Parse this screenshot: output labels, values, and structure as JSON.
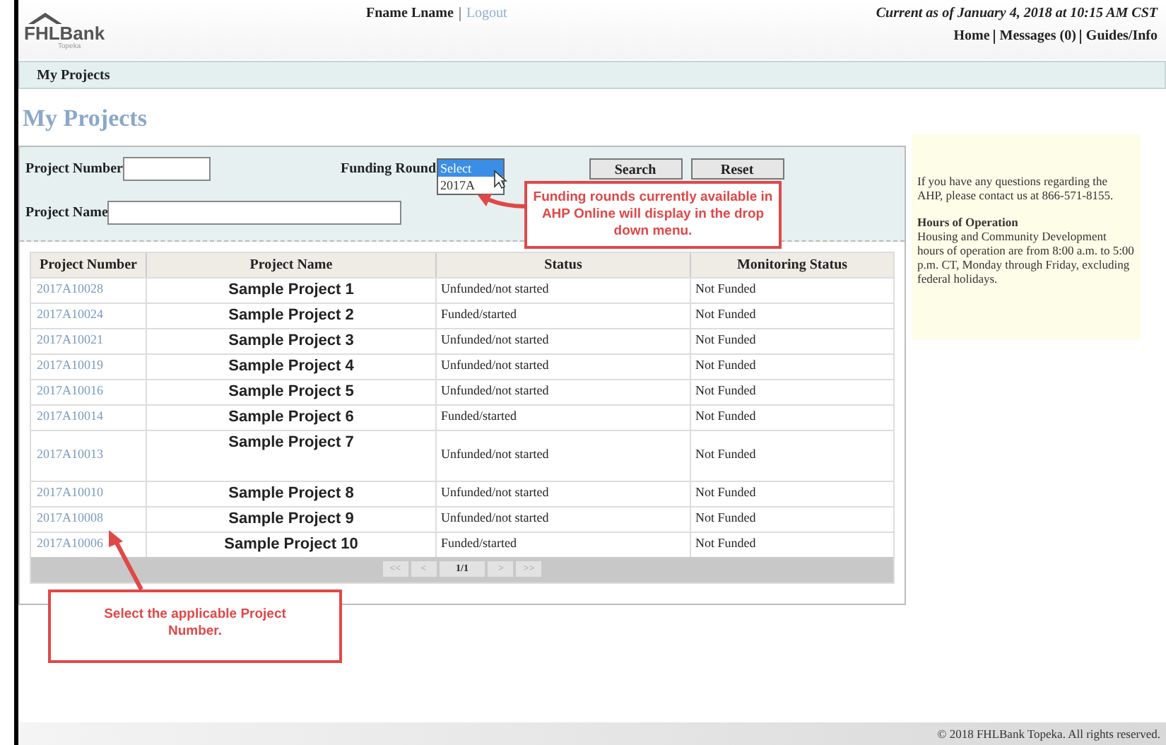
{
  "header": {
    "logo_name": "FHLBank",
    "logo_sub": "Topeka",
    "user": "Fname Lname",
    "logout": "Logout",
    "current_as_of": "Current as of January 4, 2018 at 10:15 AM CST",
    "links": [
      "Home",
      "Messages (0)",
      "Guides/Info"
    ]
  },
  "nav": {
    "items": [
      {
        "label": "My Projects",
        "selected": true
      }
    ]
  },
  "page_title": "My Projects",
  "search": {
    "project_number_label": "Project Number",
    "funding_round_label": "Funding Round",
    "project_name_label": "Project Name",
    "dropdown": {
      "expanded": true,
      "options": [
        {
          "label": "Select",
          "selected": true
        },
        {
          "label": "2017A",
          "selected": false
        }
      ]
    },
    "buttons": [
      "Search",
      "Reset"
    ]
  },
  "table": {
    "columns": [
      "Project Number",
      "Project Name",
      "Status",
      "Monitoring Status"
    ],
    "rows": [
      {
        "number": "2017A10028",
        "name": "Sample Project 1",
        "status": "Unfunded/not started",
        "monitoring": "Not Funded",
        "tall": false
      },
      {
        "number": "2017A10024",
        "name": "Sample Project 2",
        "status": "Funded/started",
        "monitoring": "Not Funded",
        "tall": false
      },
      {
        "number": "2017A10021",
        "name": "Sample Project 3",
        "status": "Unfunded/not started",
        "monitoring": "Not Funded",
        "tall": false
      },
      {
        "number": "2017A10019",
        "name": "Sample Project 4",
        "status": "Unfunded/not started",
        "monitoring": "Not Funded",
        "tall": false
      },
      {
        "number": "2017A10016",
        "name": "Sample Project 5",
        "status": "Unfunded/not started",
        "monitoring": "Not Funded",
        "tall": false
      },
      {
        "number": "2017A10014",
        "name": "Sample Project 6",
        "status": "Funded/started",
        "monitoring": "Not Funded",
        "tall": false
      },
      {
        "number": "2017A10013",
        "name": "Sample Project 7",
        "status": "Unfunded/not started",
        "monitoring": "Not Funded",
        "tall": true
      },
      {
        "number": "2017A10010",
        "name": "Sample Project 8",
        "status": "Unfunded/not started",
        "monitoring": "Not Funded",
        "tall": false
      },
      {
        "number": "2017A10008",
        "name": "Sample Project 9",
        "status": "Unfunded/not started",
        "monitoring": "Not Funded",
        "tall": false
      },
      {
        "number": "2017A10006",
        "name": "Sample Project 10",
        "status": "Funded/started",
        "monitoring": "Not Funded",
        "tall": false
      }
    ],
    "pagination": {
      "first": "<<",
      "prev": "<",
      "page": "1/1",
      "next": ">",
      "last": ">>"
    }
  },
  "info": {
    "contact": "If you have any questions regarding the AHP, please contact us at 866-571-8155.",
    "hours_title": "Hours of Operation",
    "hours_text": "Housing and Community Development hours of operation are from 8:00 a.m. to 5:00 p.m. CT, Monday through Friday, excluding federal holidays."
  },
  "callouts": [
    "Funding rounds currently available in AHP Online will display in the drop down menu.",
    "Select the applicable Project Number."
  ],
  "footer": "© 2018 FHLBank Topeka. All rights reserved."
}
